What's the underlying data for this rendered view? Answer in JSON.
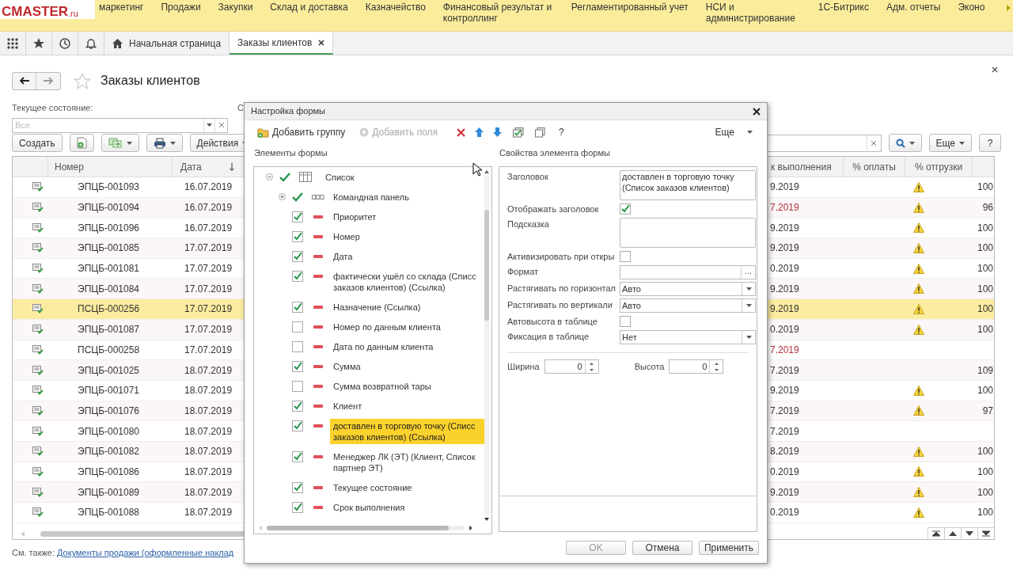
{
  "menu_bar": {
    "logo": "CMASTER",
    "logo_suffix": ".ru",
    "items": [
      "маркетинг",
      "Продажи",
      "Закупки",
      "Склад и доставка",
      "Казначейство",
      "Финансовый результат и контроллинг",
      "Регламентированный учет",
      "НСИ и администрирование",
      "1С-Битрикс",
      "Адм. отчеты",
      "Эконо"
    ]
  },
  "tab_bar": {
    "tabs": [
      {
        "label": "Начальная страница",
        "selected": false
      },
      {
        "label": "Заказы клиентов",
        "selected": true
      }
    ]
  },
  "form": {
    "title": "Заказы клиентов",
    "filter_label": "Текущее состояние:",
    "filter_placeholder": "Все",
    "second_filter_label": "С",
    "toolbar": {
      "create": "Создать",
      "actions": "Действия",
      "more": "Еще",
      "help": "?"
    },
    "table": {
      "left_columns": [
        "Номер",
        "Дата"
      ],
      "right_columns": [
        "к выполнения",
        "% оплаты",
        "% отгрузки"
      ],
      "rows": [
        {
          "number": "ЭПЦБ-001093",
          "date": "16.07.2019",
          "deadline": "9.2019",
          "overdue": false,
          "warning": true,
          "shipped": "100",
          "selected": false
        },
        {
          "number": "ЭПЦБ-001094",
          "date": "16.07.2019",
          "deadline": "7.2019",
          "overdue": true,
          "warning": true,
          "shipped": "96",
          "selected": false
        },
        {
          "number": "ЭПЦБ-001096",
          "date": "16.07.2019",
          "deadline": "9.2019",
          "overdue": false,
          "warning": true,
          "shipped": "100",
          "selected": false
        },
        {
          "number": "ЭПЦБ-001085",
          "date": "17.07.2019",
          "deadline": "9.2019",
          "overdue": false,
          "warning": true,
          "shipped": "100",
          "selected": false
        },
        {
          "number": "ЭПЦБ-001081",
          "date": "17.07.2019",
          "deadline": "0.2019",
          "overdue": false,
          "warning": true,
          "shipped": "100",
          "selected": false
        },
        {
          "number": "ЭПЦБ-001084",
          "date": "17.07.2019",
          "deadline": "9.2019",
          "overdue": false,
          "warning": true,
          "shipped": "100",
          "selected": false
        },
        {
          "number": "ПСЦБ-000256",
          "date": "17.07.2019",
          "deadline": "9.2019",
          "overdue": false,
          "warning": true,
          "shipped": "100",
          "selected": true
        },
        {
          "number": "ЭПЦБ-001087",
          "date": "17.07.2019",
          "deadline": "0.2019",
          "overdue": false,
          "warning": true,
          "shipped": "100",
          "selected": false
        },
        {
          "number": "ПСЦБ-000258",
          "date": "17.07.2019",
          "deadline": "7.2019",
          "overdue": true,
          "warning": false,
          "selected": false
        },
        {
          "number": "ЭПЦБ-001025",
          "date": "18.07.2019",
          "deadline": "7.2019",
          "overdue": false,
          "warning": false,
          "shipped": "109",
          "selected": false
        },
        {
          "number": "ЭПЦБ-001071",
          "date": "18.07.2019",
          "deadline": "9.2019",
          "overdue": false,
          "warning": true,
          "shipped": "100",
          "selected": false
        },
        {
          "number": "ЭПЦБ-001076",
          "date": "18.07.2019",
          "deadline": "7.2019",
          "overdue": false,
          "warning": true,
          "shipped": "97",
          "selected": false
        },
        {
          "number": "ЭПЦБ-001080",
          "date": "18.07.2019",
          "deadline": "7.2019",
          "overdue": false,
          "warning": false,
          "selected": false
        },
        {
          "number": "ЭПЦБ-001082",
          "date": "18.07.2019",
          "deadline": "8.2019",
          "overdue": false,
          "warning": true,
          "shipped": "100",
          "selected": false
        },
        {
          "number": "ЭПЦБ-001086",
          "date": "18.07.2019",
          "deadline": "0.2019",
          "overdue": false,
          "warning": true,
          "shipped": "100",
          "selected": false
        },
        {
          "number": "ЭПЦБ-001089",
          "date": "18.07.2019",
          "deadline": "9.2019",
          "overdue": false,
          "warning": true,
          "shipped": "100",
          "selected": false
        },
        {
          "number": "ЭПЦБ-001088",
          "date": "18.07.2019",
          "deadline": "0.2019",
          "overdue": false,
          "warning": true,
          "shipped": "100",
          "selected": false
        }
      ]
    },
    "see_also_label": "См. также:",
    "see_also_link": "Документы продажи (оформленные наклад"
  },
  "dialog": {
    "title": "Настройка формы",
    "toolbar": {
      "add_group": "Добавить группу",
      "add_fields": "Добавить поля",
      "add_fields_disabled": true,
      "help": "?",
      "more": "Еще"
    },
    "elements_label": "Элементы формы",
    "properties_label": "Свойства элемента формы",
    "tree": [
      {
        "label": "Список",
        "kind": "table",
        "checked": true,
        "expanded": true,
        "selected": false,
        "children": [
          {
            "label": "Командная панель",
            "kind": "panel",
            "checked": true,
            "expanded": false,
            "selected": false
          },
          {
            "label": "Приоритет",
            "kind": "field",
            "checked": true,
            "selected": false
          },
          {
            "label": "Номер",
            "kind": "field",
            "checked": true,
            "selected": false
          },
          {
            "label": "Дата",
            "kind": "field",
            "checked": true,
            "selected": false
          },
          {
            "label": "фактически ушёл со склада (Списс заказов клиентов) (Ссылка)",
            "kind": "field",
            "checked": true,
            "selected": false
          },
          {
            "label": "Назначение (Ссылка)",
            "kind": "field",
            "checked": true,
            "selected": false
          },
          {
            "label": "Номер по данным клиента",
            "kind": "field",
            "checked": false,
            "selected": false
          },
          {
            "label": "Дата по данным клиента",
            "kind": "field",
            "checked": false,
            "selected": false
          },
          {
            "label": "Сумма",
            "kind": "field",
            "checked": true,
            "selected": false
          },
          {
            "label": "Сумма возвратной тары",
            "kind": "field",
            "checked": false,
            "selected": false
          },
          {
            "label": "Клиент",
            "kind": "field",
            "checked": true,
            "selected": false
          },
          {
            "label": "доставлен в торговую точку (Списс заказов клиентов) (Ссылка)",
            "kind": "field",
            "checked": true,
            "selected": true
          },
          {
            "label": "Менеджер ЛК (ЭТ) (Клиент, Список партнер ЭТ)",
            "kind": "field",
            "checked": true,
            "selected": false
          },
          {
            "label": "Текущее состояние",
            "kind": "field",
            "checked": true,
            "selected": false
          },
          {
            "label": "Срок выполнения",
            "kind": "field",
            "checked": true,
            "selected": false
          }
        ]
      }
    ],
    "properties": [
      {
        "kind": "textarea",
        "label": "Заголовок",
        "value": "доставлен в торговую точку (Список заказов клиентов)"
      },
      {
        "kind": "checkbox",
        "label": "Отображать заголовок",
        "checked": true
      },
      {
        "kind": "textarea",
        "label": "Подсказка"
      },
      {
        "kind": "checkbox",
        "label": "Активизировать при откры",
        "checked": false
      },
      {
        "kind": "choice",
        "label": "Формат",
        "button": "..."
      },
      {
        "kind": "select",
        "label": "Растягивать по горизонтал",
        "value": "Авто"
      },
      {
        "kind": "select",
        "label": "Растягивать по вертикали",
        "value": "Авто"
      },
      {
        "kind": "checkbox",
        "label": "Автовысота в таблице",
        "checked": false
      },
      {
        "kind": "select",
        "label": "Фиксация в таблице",
        "value": "Нет"
      }
    ],
    "size_fields": [
      {
        "label": "Ширина",
        "value": "0"
      },
      {
        "label": "Высота",
        "value": "0"
      }
    ],
    "buttons": [
      {
        "label": "OK",
        "disabled": true
      },
      {
        "label": "Отмена",
        "disabled": false
      },
      {
        "label": "Применить",
        "disabled": false
      }
    ]
  }
}
